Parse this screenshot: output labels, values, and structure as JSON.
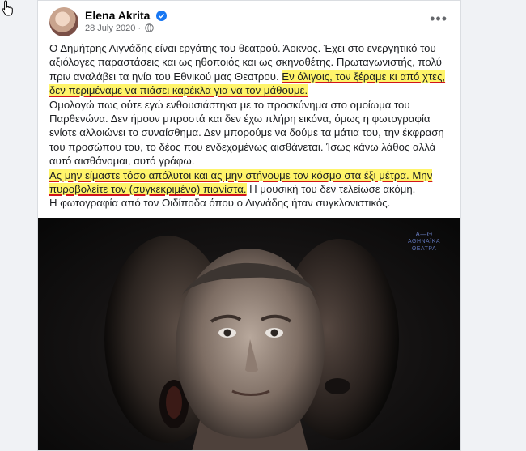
{
  "post": {
    "author": "Elena Akrita",
    "date": "28 July 2020",
    "date_separator": "·",
    "paragraph1_plain": "Ο Δημήτρης Λιγνάδης είναι εργάτης του θεατρού. Άοκνος. Έχει στο ενεργητικό του αξιόλογες παραστάσεις και ως ηθοποιός και ως σκηνοθέτης. Πρωταγωνιστής, πολύ πριν αναλάβει τα ηνία του Εθνικού μας Θεατρου. ",
    "paragraph1_highlight": "Εν όλιγοις, τον ξέραμε κι από χτες, δεν περιμέναμε να πιάσει καρέκλα για να τον μάθουμε.",
    "paragraph2": "Ομολογώ πως ούτε εγώ ενθουσιάστηκα με το προσκύνημα στο ομοίωμα του Παρθενώνα. Δεν ήμουν μπροστά και δεν έχω πλήρη εικόνα, όμως η φωτογραφία ενίοτε αλλοιώνει το συναίσθημα. Δεν μπορούμε να δούμε τα μάτια του, την έκφραση του προσώπου του, το δέος που ενδεχομένως αισθάνεται. Ίσως κάνω λάθος αλλά αυτό αισθάνομαι, αυτό γράφω.",
    "paragraph3_highlight": "Ας μην είμαστε τόσο απόλυτοι και ας μην στήνουμε τον κόσμο στα έξι μέτρα. Μην πυροβολείτε τον (συγκεκριμένο) πιανίστα.",
    "paragraph3_plain": " Η μουσική του δεν τελείωσε ακόμη.",
    "paragraph4": "Η φωτογραφία από τον Οιδίποδα όπου ο Λιγνάδης ήταν συγκλονιστικός."
  },
  "photo": {
    "logo_mark": "Α—Θ",
    "logo_line1": "ΑΘΗΝΑΪΚΑ",
    "logo_line2": "ΘΕΑΤΡΑ"
  },
  "colors": {
    "highlight": "#fff46a",
    "underline": "#d1141b",
    "verified": "#1877f2"
  },
  "icons": {
    "verified": "verified-badge-icon",
    "globe": "globe-icon",
    "more": "more-options-icon",
    "cursor": "hand-cursor-icon"
  }
}
